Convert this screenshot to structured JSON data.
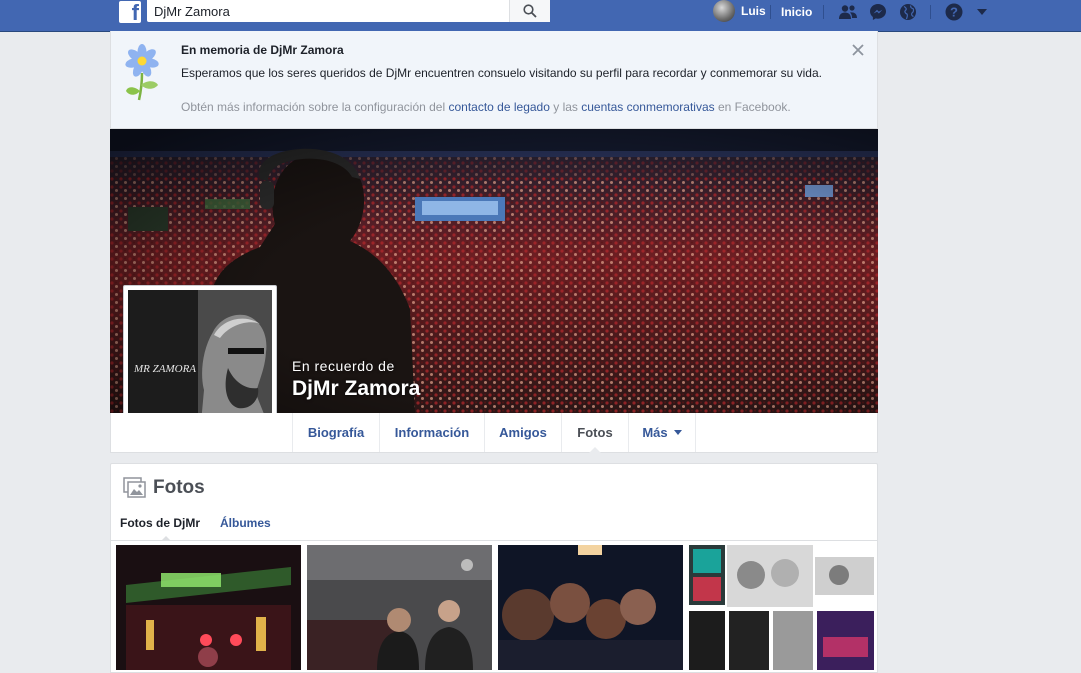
{
  "topbar": {
    "logo": "f",
    "search_value": "DjMr Zamora",
    "user_name": "Luis",
    "home_label": "Inicio",
    "icons": [
      "friends-icon",
      "messenger-icon",
      "globe-icon",
      "help-icon",
      "caret-down-icon"
    ]
  },
  "memorial": {
    "title": "En memoria de DjMr Zamora",
    "text": "Esperamos que los seres queridos de DjMr encuentren consuelo visitando su perfil para recordar y conmemorar su vida.",
    "more_prefix": "Obtén más información sobre la configuración del ",
    "legacy_link": "contacto de legado",
    "more_middle": " y las ",
    "memorial_link": "cuentas conmemorativas",
    "more_suffix": " en Facebook."
  },
  "profile": {
    "caption_small": "En recuerdo de",
    "name": "DjMr Zamora",
    "pic_text": "MR ZAMORA"
  },
  "tabs": [
    {
      "label": "Biografía"
    },
    {
      "label": "Información"
    },
    {
      "label": "Amigos"
    },
    {
      "label": "Fotos"
    },
    {
      "label": "Más"
    }
  ],
  "photos": {
    "title": "Fotos",
    "subtabs": [
      {
        "label": "Fotos de DjMr"
      },
      {
        "label": "Álbumes"
      }
    ]
  },
  "colors": {
    "brand": "#4267b2",
    "link": "#365899",
    "banner_bg": "#f1f5fa",
    "page_bg": "#e9ebee"
  }
}
